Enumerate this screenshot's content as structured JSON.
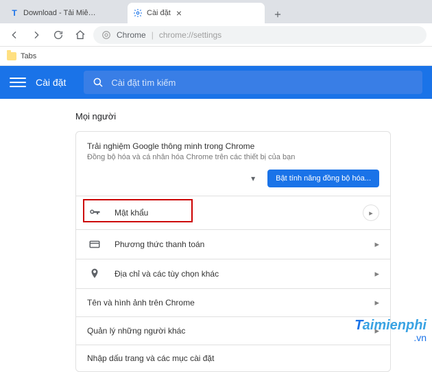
{
  "tabs": [
    {
      "title": "Download - Tải Miễn Phí VN - P",
      "favicon": "T"
    },
    {
      "title": "Cài đặt",
      "favicon": "gear"
    }
  ],
  "url": {
    "prefix": "Chrome",
    "rest": "chrome://settings"
  },
  "bookmarks": [
    {
      "label": "Tabs"
    }
  ],
  "header": {
    "title": "Cài đặt",
    "search_placeholder": "Cài đặt tìm kiếm"
  },
  "section": {
    "title": "Mọi người"
  },
  "sync": {
    "title": "Trải nghiệm Google thông minh trong Chrome",
    "sub": "Đồng bộ hóa và cá nhân hóa Chrome trên các thiết bị của bạn",
    "button": "Bật tính năng đồng bộ hóa..."
  },
  "rows": [
    {
      "key": "passwords",
      "label": "Mật khẩu",
      "icon": "key",
      "highlight": true,
      "arrow": "circle"
    },
    {
      "key": "payment",
      "label": "Phương thức thanh toán",
      "icon": "card"
    },
    {
      "key": "addresses",
      "label": "Địa chỉ và các tùy chọn khác",
      "icon": "pin"
    },
    {
      "key": "name",
      "label": "Tên và hình ảnh trên Chrome"
    },
    {
      "key": "people",
      "label": "Quản lý những người khác"
    },
    {
      "key": "import",
      "label": "Nhập dấu trang và các mục cài đặt"
    }
  ],
  "watermark": {
    "brand": "aimienphi",
    "t": "T",
    "domain": ".vn"
  }
}
